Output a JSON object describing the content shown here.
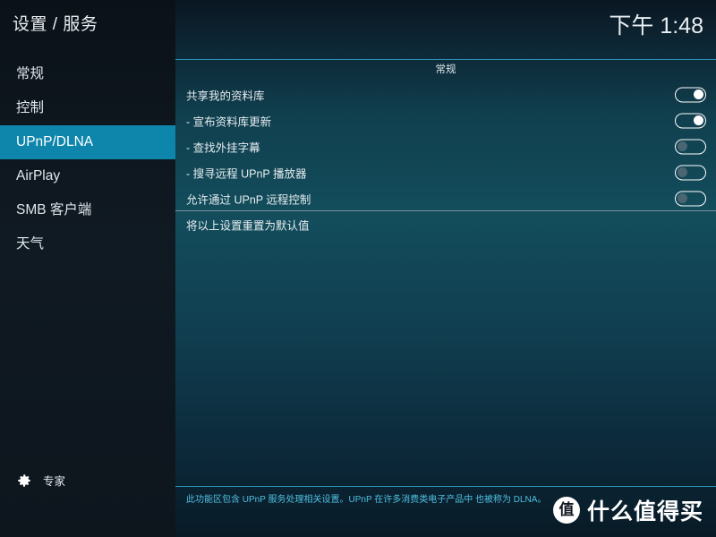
{
  "window": {
    "title": "设置 / 服务",
    "clock": "下午 1:48"
  },
  "sidebar": {
    "items": [
      {
        "label": "常规",
        "selected": false
      },
      {
        "label": "控制",
        "selected": false
      },
      {
        "label": "UPnP/DLNA",
        "selected": true
      },
      {
        "label": "AirPlay",
        "selected": false
      },
      {
        "label": "SMB 客户端",
        "selected": false
      },
      {
        "label": "天气",
        "selected": false
      }
    ],
    "expert": {
      "label": "专家",
      "icon": "gear-icon"
    }
  },
  "main": {
    "group_header": "常规",
    "settings": [
      {
        "label": "共享我的资料库",
        "toggle": "on"
      },
      {
        "label": "- 宣布资料库更新",
        "toggle": "on"
      },
      {
        "label": "- 查找外挂字幕",
        "toggle": "off"
      },
      {
        "label": "- 搜寻远程 UPnP 播放器",
        "toggle": "off"
      },
      {
        "label": "允许通过 UPnP 远程控制",
        "toggle": "off"
      }
    ],
    "reset_label": "将以上设置重置为默认值",
    "help_text": "此功能区包含 UPnP 服务处理相关设置。UPnP 在许多消费类电子产品中 也被称为 DLNA。"
  },
  "watermark": {
    "badge": "值",
    "text": "什么值得买"
  },
  "colors": {
    "accent": "#0e86ac",
    "rule": "#2c91b4",
    "help": "#4fbfe0",
    "sidebar_bg": "#101a23"
  }
}
